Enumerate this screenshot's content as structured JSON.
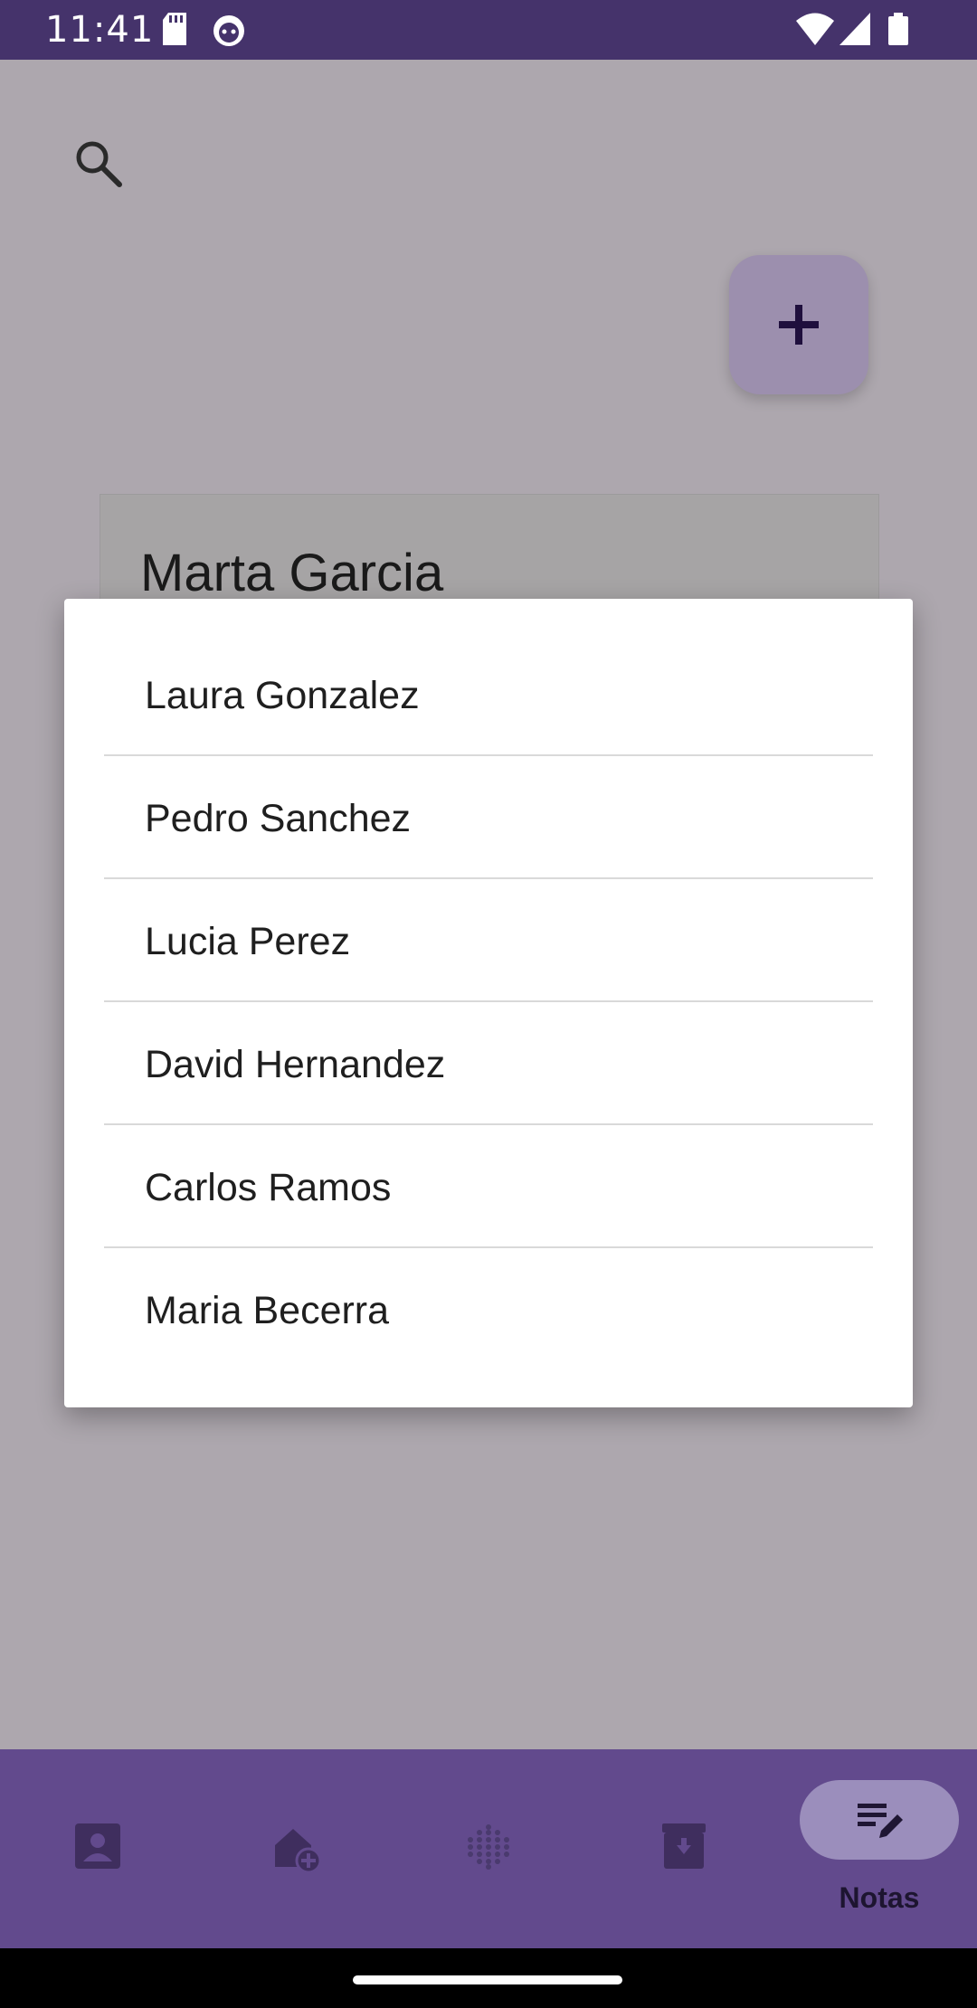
{
  "status_bar": {
    "time": "11:41",
    "left_icons": [
      "sd-card-icon",
      "cat-face-icon"
    ],
    "right_icons": [
      "wifi-icon",
      "cell-signal-icon",
      "battery-icon"
    ]
  },
  "background": {
    "note_card_title": "Marta Garcia"
  },
  "dialog": {
    "items": [
      {
        "label": "Laura Gonzalez"
      },
      {
        "label": "Pedro Sanchez"
      },
      {
        "label": "Lucia Perez"
      },
      {
        "label": "David Hernandez"
      },
      {
        "label": "Carlos Ramos"
      },
      {
        "label": "Maria Becerra"
      }
    ]
  },
  "bottom_nav": {
    "items": [
      {
        "icon": "contact-icon",
        "label": ""
      },
      {
        "icon": "add-home-icon",
        "label": ""
      },
      {
        "icon": "dots-grid-icon",
        "label": ""
      },
      {
        "icon": "archive-icon",
        "label": ""
      },
      {
        "icon": "notes-edit-icon",
        "label": "Notas",
        "active": true
      }
    ]
  },
  "colors": {
    "status_bar": "#45336b",
    "scrim_background": "#ada7ae",
    "fab": "#9c8fae",
    "bottom_nav": "#624a8d",
    "active_pill": "#9b8ebc",
    "dialog": "#ffffff"
  }
}
